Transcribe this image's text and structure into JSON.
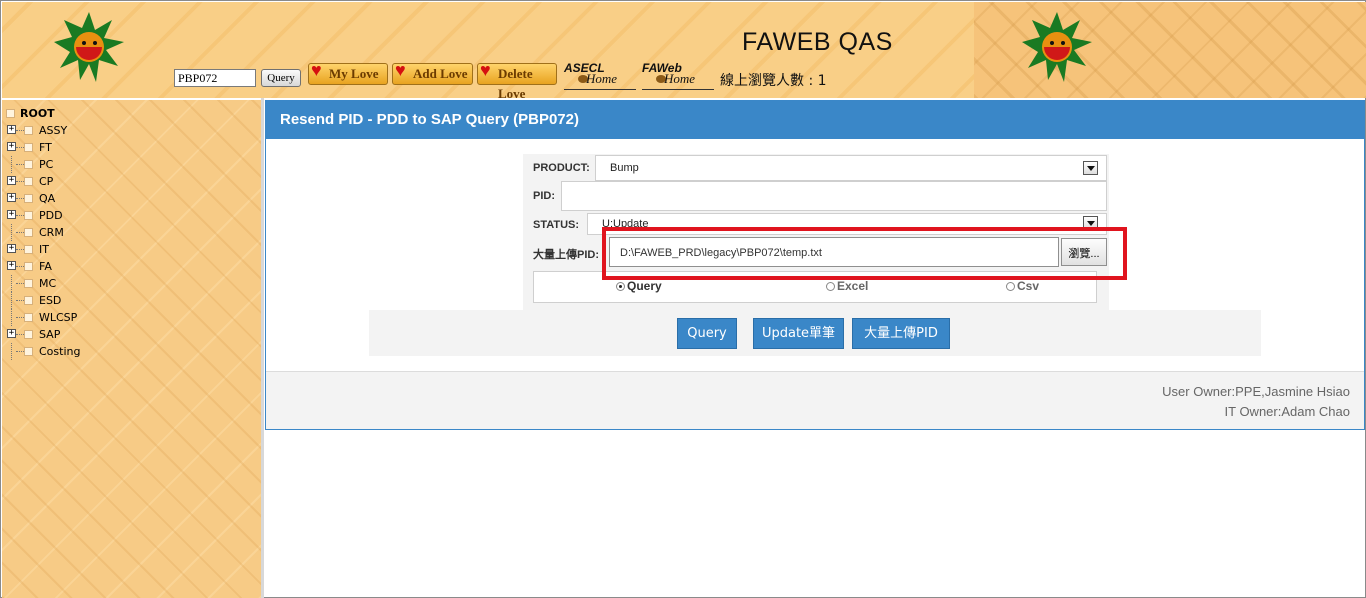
{
  "header": {
    "app_title": "FAWEB QAS",
    "pid_value": "PBP072",
    "query_label": "Query",
    "my_love_label": "My Love",
    "add_love_label": "Add Love",
    "delete_love_label": "Delete Love",
    "asecl_home": {
      "top": "ASECL",
      "bottom": "Home"
    },
    "faweb_home": {
      "top": "FAWeb",
      "bottom": "Home"
    },
    "online_count": "線上瀏覽人數 : 1"
  },
  "sidebar": {
    "root_label": "ROOT",
    "items": [
      {
        "label": "ASSY",
        "expandable": true
      },
      {
        "label": "FT",
        "expandable": true
      },
      {
        "label": "PC",
        "expandable": false
      },
      {
        "label": "CP",
        "expandable": true
      },
      {
        "label": "QA",
        "expandable": true
      },
      {
        "label": "PDD",
        "expandable": true
      },
      {
        "label": "CRM",
        "expandable": false
      },
      {
        "label": "IT",
        "expandable": true
      },
      {
        "label": "FA",
        "expandable": true
      },
      {
        "label": "MC",
        "expandable": false
      },
      {
        "label": "ESD",
        "expandable": false
      },
      {
        "label": "WLCSP",
        "expandable": false
      },
      {
        "label": "SAP",
        "expandable": true
      },
      {
        "label": "Costing",
        "expandable": false
      }
    ]
  },
  "panel": {
    "title": "Resend PID - PDD to SAP Query (PBP072)",
    "product_label": "PRODUCT:",
    "product_value": "Bump",
    "pid_label": "PID:",
    "pid_value": "",
    "status_label": "STATUS:",
    "status_value": "U:Update",
    "upload_label": "大量上傳PID:",
    "upload_path": "D:\\FAWEB_PRD\\legacy\\PBP072\\temp.txt",
    "browse_label": "瀏覽...",
    "radios": {
      "query": "Query",
      "excel": "Excel",
      "csv": "Csv",
      "selected": "Query"
    },
    "buttons": {
      "query": "Query",
      "update": "Update單筆",
      "bulk": "大量上傳PID"
    },
    "footer": {
      "user_owner": "User Owner:PPE,Jasmine Hsiao",
      "it_owner": "IT Owner:Adam Chao"
    }
  },
  "colors": {
    "accent": "#3a87c8",
    "highlight": "#e0141e",
    "header_bg": "#f9cf87"
  }
}
